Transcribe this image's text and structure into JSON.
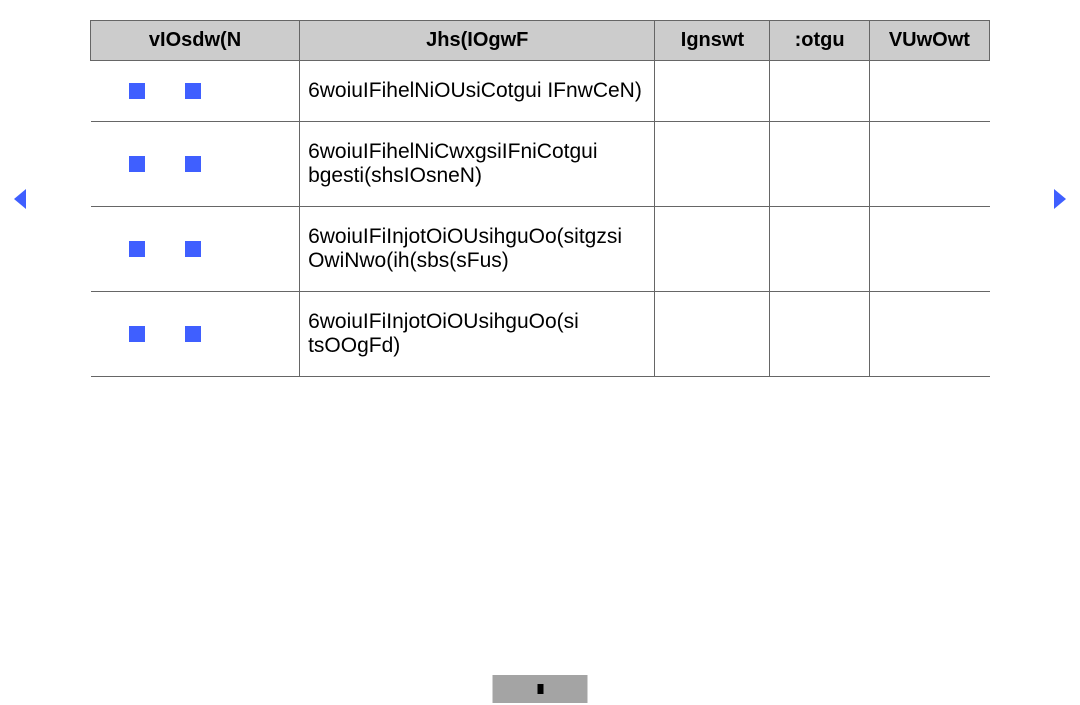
{
  "table": {
    "headers": {
      "col1": "vIOsdw(N",
      "col2": "Jhs(IOgwF",
      "col3": "Ignswt",
      "col4": ":otgu",
      "col5": "VUwOwt"
    },
    "rows": [
      {
        "desc": "6woiuIFihelNiOUsiCotgui IFnwCeN)",
        "c": "",
        "d": "",
        "e": ""
      },
      {
        "desc": "6woiuIFihelNiCwxgsiIFniCotgui bgesti(shsIOsneN)",
        "c": "",
        "d": "",
        "e": ""
      },
      {
        "desc": "6woiuIFiInjotOiOUsihguOo(sitgzsi OwiNwo(ih(sbs(sFus)",
        "c": "",
        "d": "",
        "e": ""
      },
      {
        "desc": "6woiuIFiInjotOiOUsihguOo(si tsOOgFd)",
        "c": "",
        "d": "",
        "e": ""
      }
    ]
  },
  "icons": {
    "edit": "edit",
    "delete": "delete"
  },
  "nav": {
    "prev": "previous",
    "next": "next"
  },
  "pager": {
    "label": ""
  }
}
